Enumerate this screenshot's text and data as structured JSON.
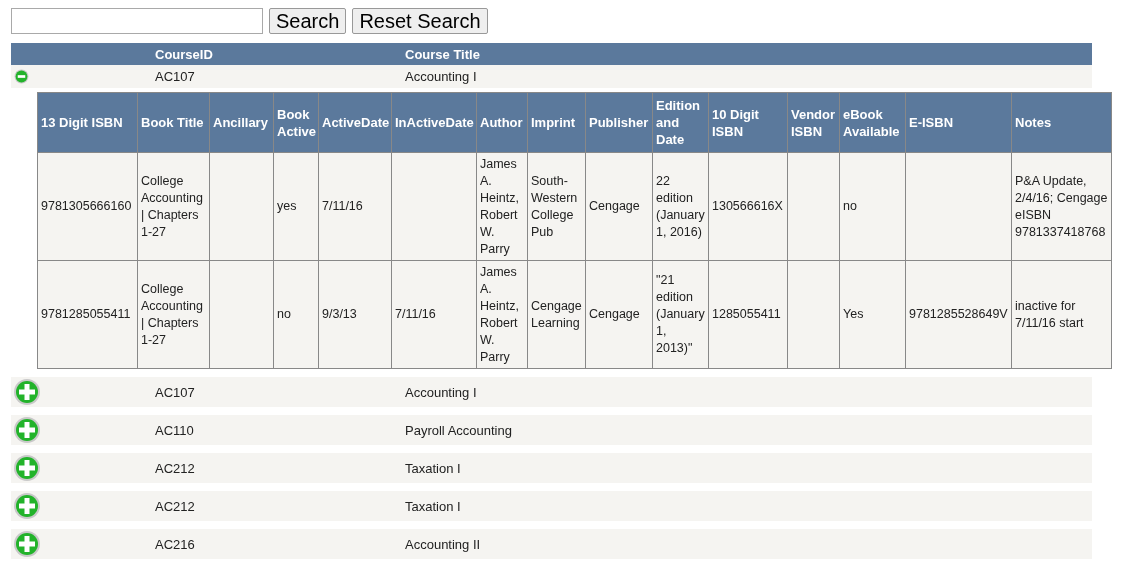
{
  "search": {
    "buttons": [
      "Search",
      "Reset Search"
    ]
  },
  "courses_table": {
    "columns": [
      "CourseID",
      "Course Title"
    ],
    "rows": [
      {
        "course_id": "AC107",
        "course_title": "Accounting I",
        "expanded": true,
        "books": {
          "columns": [
            "13 Digit ISBN",
            "Book Title",
            "Ancillary",
            "Book Active",
            "ActiveDate",
            "InActiveDate",
            "Author",
            "Imprint",
            "Publisher",
            "Edition and Date",
            "10 Digit ISBN",
            "Vendor ISBN",
            "eBook Available",
            "E-ISBN",
            "Notes"
          ],
          "rows": [
            [
              "9781305666160",
              "College Accounting| Chapters 1-27",
              "",
              "yes",
              "7/11/16",
              "",
              "James A. Heintz, Robert W. Parry",
              "South-Western College Pub",
              "Cengage",
              "22 edition (January 1, 2016)",
              "130566616X",
              "",
              "no",
              "",
              "P&A Update, 2/4/16; Cengage eISBN 9781337418768"
            ],
            [
              "9781285055411",
              "College Accounting| Chapters 1-27",
              "",
              "no",
              "9/3/13",
              "7/11/16",
              "James A. Heintz, Robert W. Parry",
              "Cengage Learning",
              "Cengage",
              "\"21 edition (January 1, 2013)\"",
              "1285055411",
              "",
              "Yes",
              "9781285528649V",
              "inactive for 7/11/16 start"
            ]
          ]
        }
      },
      {
        "course_id": "AC107",
        "course_title": "Accounting I",
        "expanded": false
      },
      {
        "course_id": "AC110",
        "course_title": "Payroll Accounting",
        "expanded": false
      },
      {
        "course_id": "AC212",
        "course_title": "Taxation I",
        "expanded": false
      },
      {
        "course_id": "AC212",
        "course_title": "Taxation I",
        "expanded": false
      },
      {
        "course_id": "AC216",
        "course_title": "Accounting II",
        "expanded": false
      }
    ]
  }
}
